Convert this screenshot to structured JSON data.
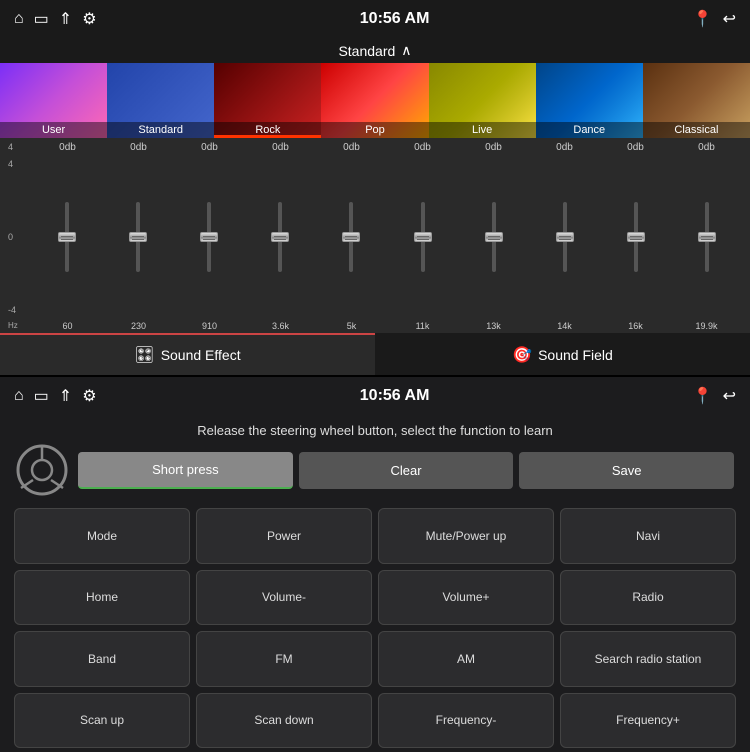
{
  "top": {
    "status_bar": {
      "time": "10:56 AM"
    },
    "preset_label": "Standard",
    "presets": [
      {
        "id": "user",
        "label": "User",
        "active": false
      },
      {
        "id": "standard",
        "label": "Standard",
        "active": true
      },
      {
        "id": "rock",
        "label": "Rock",
        "active": false
      },
      {
        "id": "pop",
        "label": "Pop",
        "active": false
      },
      {
        "id": "live",
        "label": "Live",
        "active": false
      },
      {
        "id": "dance",
        "label": "Dance",
        "active": false
      },
      {
        "id": "classical",
        "label": "Classical",
        "active": false
      }
    ],
    "eq": {
      "db_labels": [
        "0db",
        "0db",
        "0db",
        "0db",
        "0db",
        "0db",
        "0db",
        "0db",
        "0db",
        "0db"
      ],
      "side_labels": [
        "4",
        "0",
        "-4"
      ],
      "hz_label": "Hz",
      "freq_labels": [
        "60",
        "230",
        "910",
        "3.6k",
        "5k",
        "11k",
        "13k",
        "14k",
        "16k",
        "19.9k"
      ]
    },
    "tabs": [
      {
        "id": "sound-effect",
        "label": "Sound Effect",
        "icon": "🎛",
        "active": true
      },
      {
        "id": "sound-field",
        "label": "Sound Field",
        "icon": "🎯",
        "active": false
      }
    ]
  },
  "bottom": {
    "status_bar": {
      "time": "10:56 AM"
    },
    "instruction": "Release the steering wheel button, select the function to learn",
    "controls": {
      "short_press_label": "Short press",
      "clear_label": "Clear",
      "save_label": "Save"
    },
    "grid_buttons": [
      "Mode",
      "Power",
      "Mute/Power up",
      "Navi",
      "Home",
      "Volume-",
      "Volume+",
      "Radio",
      "Band",
      "FM",
      "AM",
      "Search radio station",
      "Scan up",
      "Scan down",
      "Frequency-",
      "Frequency+"
    ]
  }
}
